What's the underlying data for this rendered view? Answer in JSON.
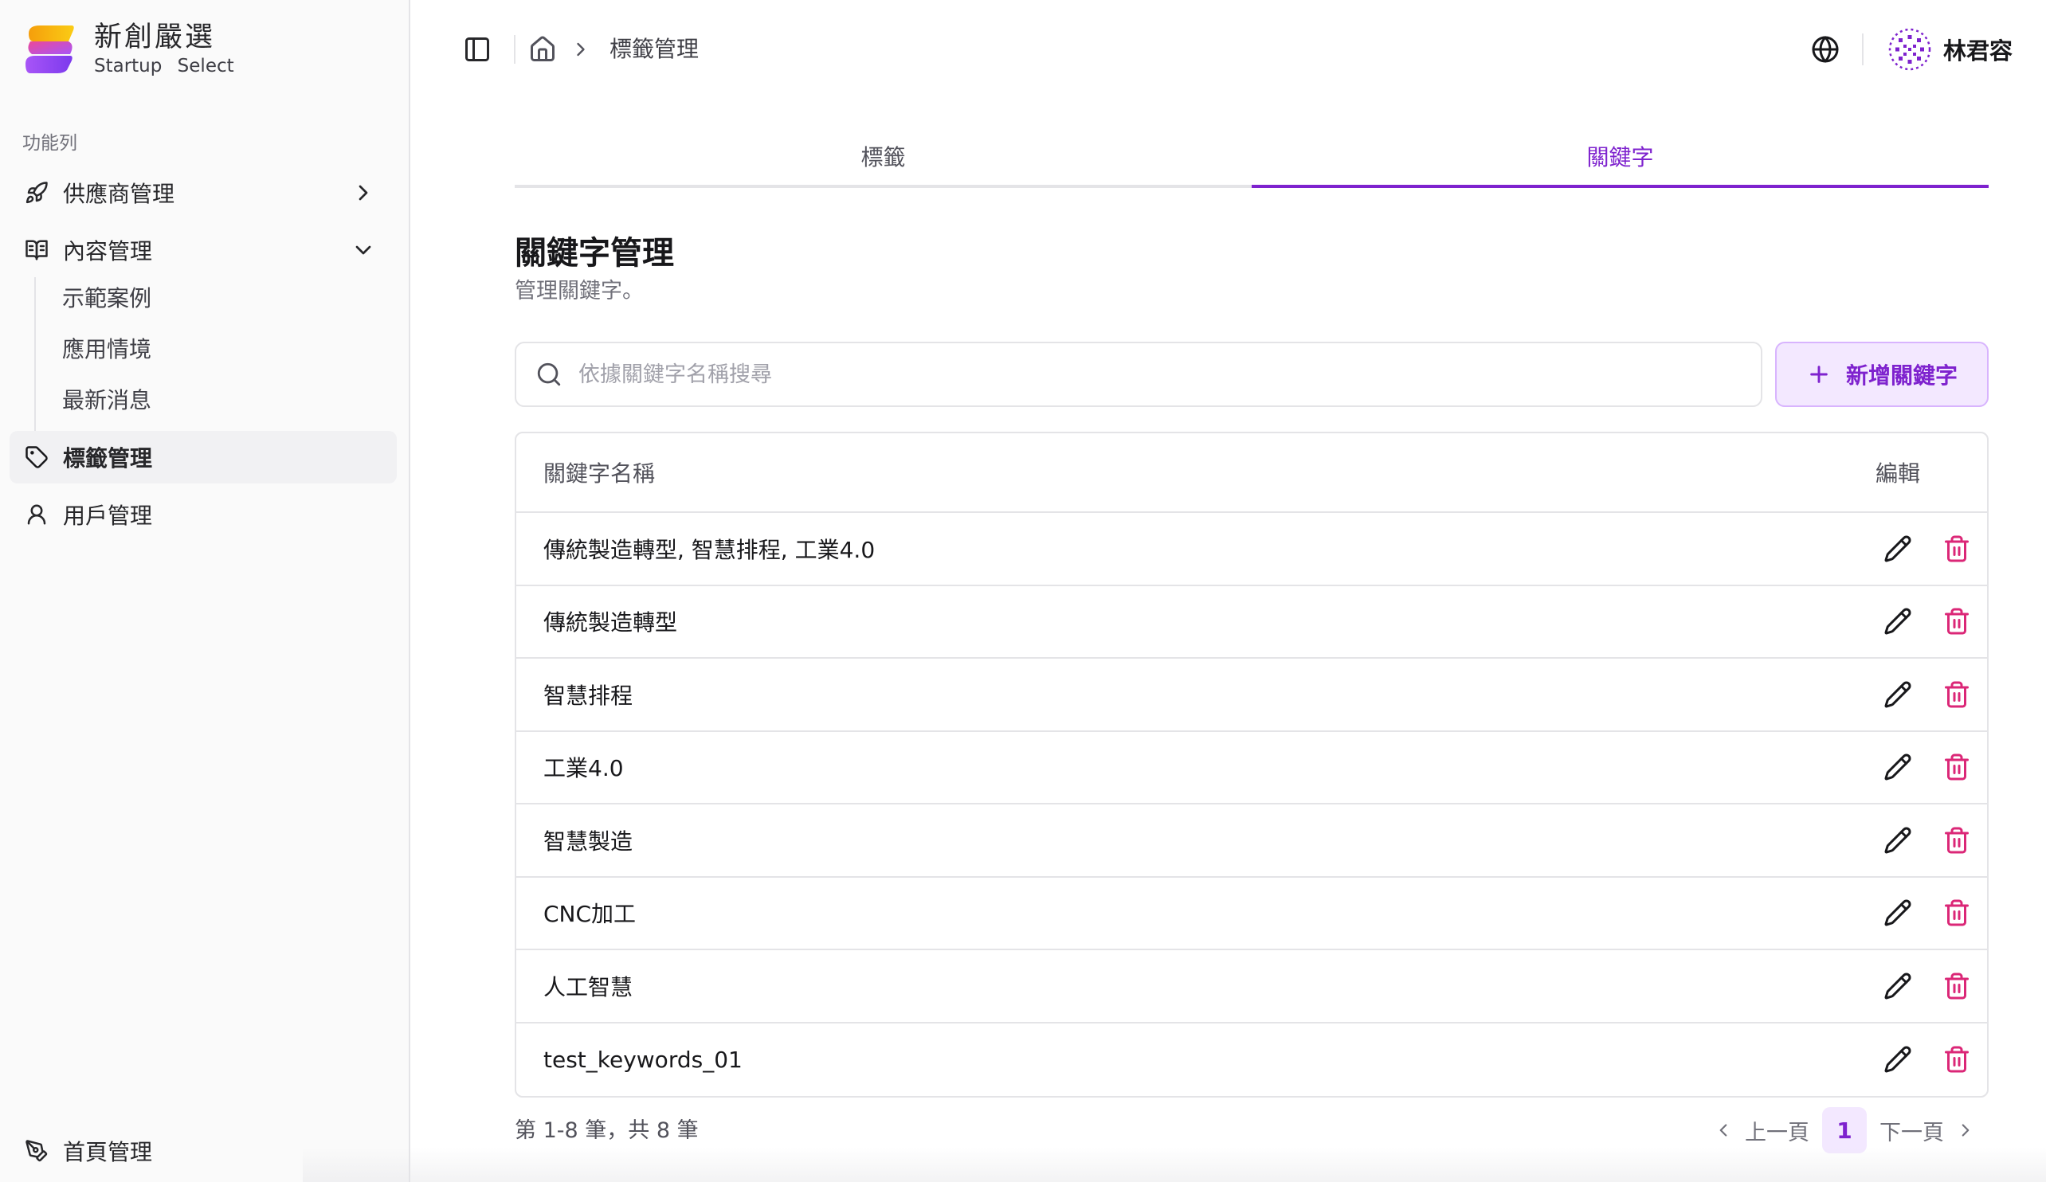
{
  "brand": {
    "name_zh": "新創嚴選",
    "name_en": "Startup Select"
  },
  "sidebar": {
    "section_label": "功能列",
    "items": [
      {
        "label": "供應商管理",
        "icon": "rocket-icon",
        "expandable": true,
        "expanded": false
      },
      {
        "label": "內容管理",
        "icon": "book-open-icon",
        "expandable": true,
        "expanded": true,
        "children": [
          {
            "label": "示範案例"
          },
          {
            "label": "應用情境"
          },
          {
            "label": "最新消息"
          }
        ]
      },
      {
        "label": "標籤管理",
        "icon": "tag-icon",
        "active": true
      },
      {
        "label": "用戶管理",
        "icon": "user-icon"
      }
    ],
    "footer_item": {
      "label": "首頁管理",
      "icon": "pen-tool-icon"
    }
  },
  "header": {
    "breadcrumb": {
      "home_icon": "home-icon",
      "current": "標籤管理"
    },
    "user": {
      "name": "林君容"
    }
  },
  "tabs": [
    {
      "label": "標籤",
      "active": false
    },
    {
      "label": "關鍵字",
      "active": true
    }
  ],
  "page": {
    "title": "關鍵字管理",
    "subtitle": "管理關鍵字。"
  },
  "search": {
    "placeholder": "依據關鍵字名稱搜尋",
    "value": ""
  },
  "add_button": {
    "label": "新增關鍵字"
  },
  "table": {
    "columns": [
      "關鍵字名稱",
      "編輯"
    ],
    "rows": [
      "傳統製造轉型, 智慧排程, 工業4.0",
      "傳統製造轉型",
      "智慧排程",
      "工業4.0",
      "智慧製造",
      "CNC加工",
      "人工智慧",
      "test_keywords_01"
    ]
  },
  "pagination": {
    "summary": "第 1-8 筆，共 8 筆",
    "prev": "上一頁",
    "next": "下一頁",
    "current": "1"
  },
  "colors": {
    "accent": "#7e22ce",
    "accent_bg": "#f3e8ff",
    "danger": "#db2777",
    "sidebar_bg": "#fafafa",
    "border": "#e4e4e7"
  }
}
